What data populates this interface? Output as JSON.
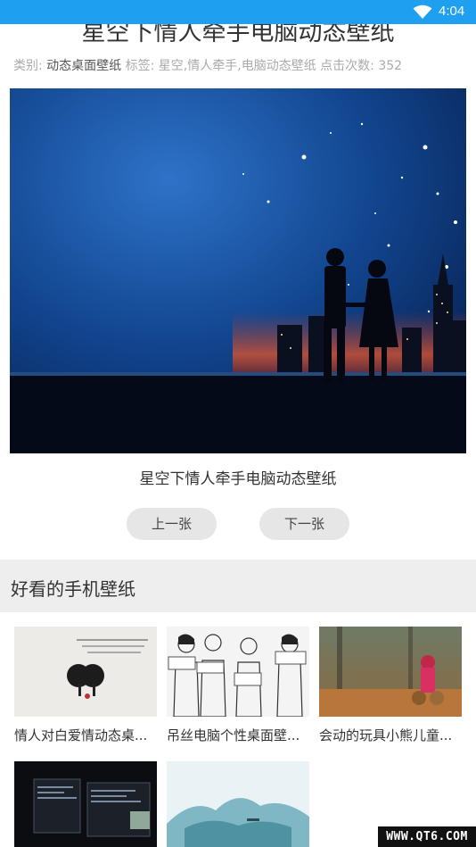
{
  "status": {
    "time": "4:04"
  },
  "header": {
    "title": "星空下情人牵手电脑动态壁纸"
  },
  "meta": {
    "category_label": "类别:",
    "category_value": "动态桌面壁纸",
    "tags_label": "标签:",
    "tags_value": "星空,情人牵手,电脑动态壁纸",
    "clicks_label": "点击次数:",
    "clicks_value": "352"
  },
  "main": {
    "caption": "星空下情人牵手电脑动态壁纸"
  },
  "nav": {
    "prev_label": "上一张",
    "next_label": "下一张"
  },
  "section": {
    "title": "好看的手机壁纸"
  },
  "thumbnails": [
    {
      "label": "情人对白爱情动态桌..."
    },
    {
      "label": "吊丝电脑个性桌面壁..."
    },
    {
      "label": "会动的玩具小熊儿童..."
    },
    {
      "label": ""
    },
    {
      "label": ""
    }
  ],
  "watermark": "WWW.QT6.COM",
  "colors": {
    "statusbar": "#1e9ff0",
    "button_bg": "#e6e6e6",
    "section_bg": "#eeeeee"
  }
}
